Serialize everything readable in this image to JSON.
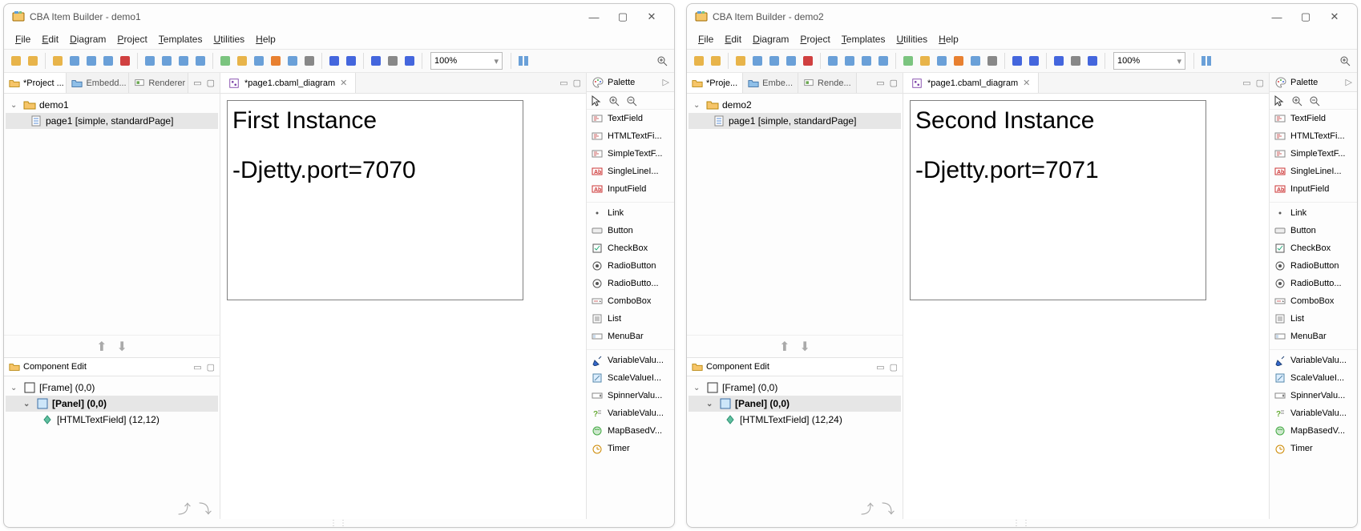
{
  "app_name": "CBA Item Builder",
  "menus": [
    "File",
    "Edit",
    "Diagram",
    "Project",
    "Templates",
    "Utilities",
    "Help"
  ],
  "zoom": "100%",
  "editor_tab": "*page1.cbaml_diagram",
  "palette_title": "Palette",
  "palette_items": [
    {
      "ico": "txt",
      "label": "TextField"
    },
    {
      "ico": "txt",
      "label": "HTMLTextFi..."
    },
    {
      "ico": "txt",
      "label": "SimpleTextF..."
    },
    {
      "ico": "ab",
      "label": "SingleLineI..."
    },
    {
      "ico": "ab",
      "label": "InputField"
    },
    {
      "ico": "gap",
      "label": ""
    },
    {
      "ico": "link",
      "label": "Link"
    },
    {
      "ico": "btn",
      "label": "Button"
    },
    {
      "ico": "chk",
      "label": "CheckBox"
    },
    {
      "ico": "rad",
      "label": "RadioButton"
    },
    {
      "ico": "rad",
      "label": "RadioButto..."
    },
    {
      "ico": "cmb",
      "label": "ComboBox"
    },
    {
      "ico": "lst",
      "label": "List"
    },
    {
      "ico": "mnu",
      "label": "MenuBar"
    },
    {
      "ico": "gap",
      "label": ""
    },
    {
      "ico": "pen",
      "label": "VariableValu..."
    },
    {
      "ico": "scl",
      "label": "ScaleValueI..."
    },
    {
      "ico": "spn",
      "label": "SpinnerValu..."
    },
    {
      "ico": "var",
      "label": "VariableValu..."
    },
    {
      "ico": "map",
      "label": "MapBasedV..."
    },
    {
      "ico": "tmr",
      "label": "Timer"
    }
  ],
  "windows": [
    {
      "title_suffix": "demo1",
      "left_tabs": [
        "*Project ...",
        "Embedd...",
        "Renderer"
      ],
      "project_name": "demo1",
      "page_label": "page1 [simple, standardPage]",
      "canvas_line1": "First Instance",
      "canvas_line2": "-Djetty.port=7070",
      "comp_title": "Component Edit",
      "comp_tree": {
        "frame": "[Frame] (0,0)",
        "panel": "[Panel] (0,0)",
        "field": "[HTMLTextField] (12,12)"
      }
    },
    {
      "title_suffix": "demo2",
      "left_tabs": [
        "*Proje...",
        "Embe...",
        "Rende..."
      ],
      "project_name": "demo2",
      "page_label": "page1 [simple, standardPage]",
      "canvas_line1": "Second Instance",
      "canvas_line2": "-Djetty.port=7071",
      "comp_title": "Component Edit",
      "comp_tree": {
        "frame": "[Frame] (0,0)",
        "panel": "[Panel] (0,0)",
        "field": "[HTMLTextField] (12,24)"
      }
    }
  ]
}
